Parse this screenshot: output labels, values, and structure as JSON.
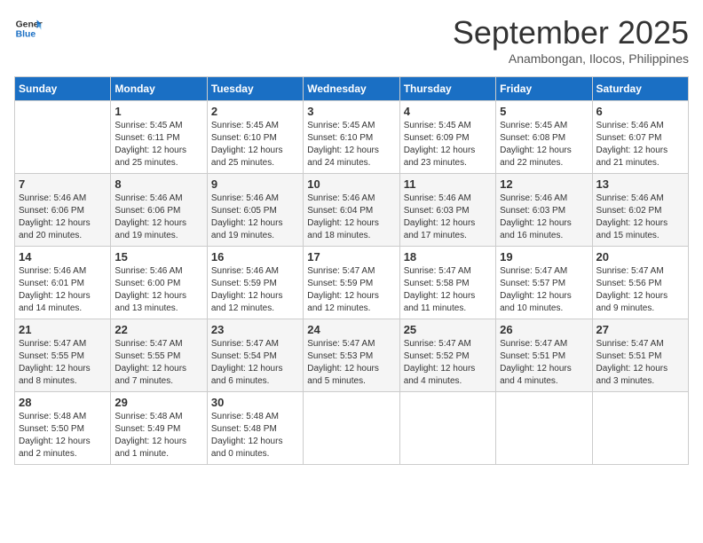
{
  "header": {
    "logo_line1": "General",
    "logo_line2": "Blue",
    "month": "September 2025",
    "location": "Anambongan, Ilocos, Philippines"
  },
  "weekdays": [
    "Sunday",
    "Monday",
    "Tuesday",
    "Wednesday",
    "Thursday",
    "Friday",
    "Saturday"
  ],
  "weeks": [
    [
      {
        "day": "",
        "info": ""
      },
      {
        "day": "1",
        "info": "Sunrise: 5:45 AM\nSunset: 6:11 PM\nDaylight: 12 hours\nand 25 minutes."
      },
      {
        "day": "2",
        "info": "Sunrise: 5:45 AM\nSunset: 6:10 PM\nDaylight: 12 hours\nand 25 minutes."
      },
      {
        "day": "3",
        "info": "Sunrise: 5:45 AM\nSunset: 6:10 PM\nDaylight: 12 hours\nand 24 minutes."
      },
      {
        "day": "4",
        "info": "Sunrise: 5:45 AM\nSunset: 6:09 PM\nDaylight: 12 hours\nand 23 minutes."
      },
      {
        "day": "5",
        "info": "Sunrise: 5:45 AM\nSunset: 6:08 PM\nDaylight: 12 hours\nand 22 minutes."
      },
      {
        "day": "6",
        "info": "Sunrise: 5:46 AM\nSunset: 6:07 PM\nDaylight: 12 hours\nand 21 minutes."
      }
    ],
    [
      {
        "day": "7",
        "info": "Sunrise: 5:46 AM\nSunset: 6:06 PM\nDaylight: 12 hours\nand 20 minutes."
      },
      {
        "day": "8",
        "info": "Sunrise: 5:46 AM\nSunset: 6:06 PM\nDaylight: 12 hours\nand 19 minutes."
      },
      {
        "day": "9",
        "info": "Sunrise: 5:46 AM\nSunset: 6:05 PM\nDaylight: 12 hours\nand 19 minutes."
      },
      {
        "day": "10",
        "info": "Sunrise: 5:46 AM\nSunset: 6:04 PM\nDaylight: 12 hours\nand 18 minutes."
      },
      {
        "day": "11",
        "info": "Sunrise: 5:46 AM\nSunset: 6:03 PM\nDaylight: 12 hours\nand 17 minutes."
      },
      {
        "day": "12",
        "info": "Sunrise: 5:46 AM\nSunset: 6:03 PM\nDaylight: 12 hours\nand 16 minutes."
      },
      {
        "day": "13",
        "info": "Sunrise: 5:46 AM\nSunset: 6:02 PM\nDaylight: 12 hours\nand 15 minutes."
      }
    ],
    [
      {
        "day": "14",
        "info": "Sunrise: 5:46 AM\nSunset: 6:01 PM\nDaylight: 12 hours\nand 14 minutes."
      },
      {
        "day": "15",
        "info": "Sunrise: 5:46 AM\nSunset: 6:00 PM\nDaylight: 12 hours\nand 13 minutes."
      },
      {
        "day": "16",
        "info": "Sunrise: 5:46 AM\nSunset: 5:59 PM\nDaylight: 12 hours\nand 12 minutes."
      },
      {
        "day": "17",
        "info": "Sunrise: 5:47 AM\nSunset: 5:59 PM\nDaylight: 12 hours\nand 12 minutes."
      },
      {
        "day": "18",
        "info": "Sunrise: 5:47 AM\nSunset: 5:58 PM\nDaylight: 12 hours\nand 11 minutes."
      },
      {
        "day": "19",
        "info": "Sunrise: 5:47 AM\nSunset: 5:57 PM\nDaylight: 12 hours\nand 10 minutes."
      },
      {
        "day": "20",
        "info": "Sunrise: 5:47 AM\nSunset: 5:56 PM\nDaylight: 12 hours\nand 9 minutes."
      }
    ],
    [
      {
        "day": "21",
        "info": "Sunrise: 5:47 AM\nSunset: 5:55 PM\nDaylight: 12 hours\nand 8 minutes."
      },
      {
        "day": "22",
        "info": "Sunrise: 5:47 AM\nSunset: 5:55 PM\nDaylight: 12 hours\nand 7 minutes."
      },
      {
        "day": "23",
        "info": "Sunrise: 5:47 AM\nSunset: 5:54 PM\nDaylight: 12 hours\nand 6 minutes."
      },
      {
        "day": "24",
        "info": "Sunrise: 5:47 AM\nSunset: 5:53 PM\nDaylight: 12 hours\nand 5 minutes."
      },
      {
        "day": "25",
        "info": "Sunrise: 5:47 AM\nSunset: 5:52 PM\nDaylight: 12 hours\nand 4 minutes."
      },
      {
        "day": "26",
        "info": "Sunrise: 5:47 AM\nSunset: 5:51 PM\nDaylight: 12 hours\nand 4 minutes."
      },
      {
        "day": "27",
        "info": "Sunrise: 5:47 AM\nSunset: 5:51 PM\nDaylight: 12 hours\nand 3 minutes."
      }
    ],
    [
      {
        "day": "28",
        "info": "Sunrise: 5:48 AM\nSunset: 5:50 PM\nDaylight: 12 hours\nand 2 minutes."
      },
      {
        "day": "29",
        "info": "Sunrise: 5:48 AM\nSunset: 5:49 PM\nDaylight: 12 hours\nand 1 minute."
      },
      {
        "day": "30",
        "info": "Sunrise: 5:48 AM\nSunset: 5:48 PM\nDaylight: 12 hours\nand 0 minutes."
      },
      {
        "day": "",
        "info": ""
      },
      {
        "day": "",
        "info": ""
      },
      {
        "day": "",
        "info": ""
      },
      {
        "day": "",
        "info": ""
      }
    ]
  ]
}
